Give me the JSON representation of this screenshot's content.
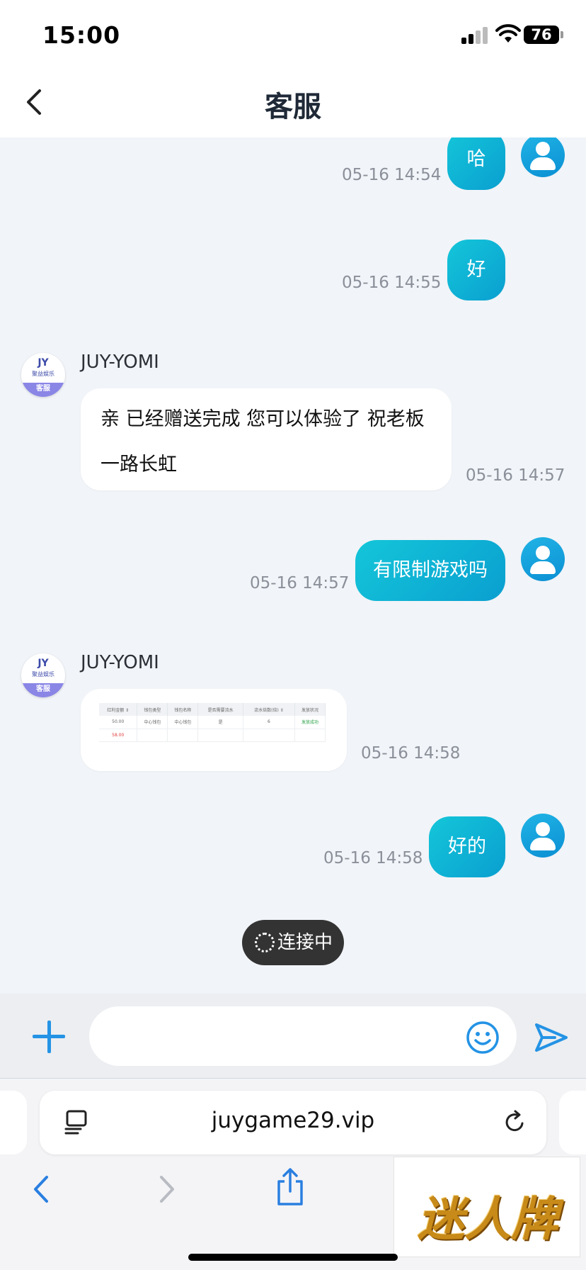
{
  "status_bar": {
    "time": "15:00",
    "battery": "76"
  },
  "header": {
    "title": "客服"
  },
  "messages": {
    "m1": {
      "text": "哈",
      "time": "05-16 14:54"
    },
    "m2": {
      "text": "好",
      "time": "05-16 14:55"
    },
    "m3": {
      "sender": "JUY-YOMI",
      "line1": "亲  已经赠送完成   您可以体验了   祝老板",
      "line2": "一路长虹",
      "time": "05-16 14:57"
    },
    "m4": {
      "text": "有限制游戏吗",
      "time": "05-16 14:57"
    },
    "m5": {
      "sender": "JUY-YOMI",
      "time": "05-16 14:58",
      "image_table": {
        "headers": [
          "红利金额 ⇕",
          "钱包类型",
          "钱包名称",
          "是否需要流水",
          "流水倍数(倍) ⇕",
          "发放状况"
        ],
        "row1": [
          "50.00",
          "中心钱包",
          "中心钱包",
          "是",
          "6",
          "发放成功"
        ],
        "row2": [
          "58.00",
          "",
          "",
          "",
          "",
          ""
        ]
      }
    },
    "m6": {
      "text": "好的",
      "time": "05-16 14:58"
    }
  },
  "agent_avatar": {
    "logo": "JY",
    "brand": "聚益娱乐",
    "ribbon": "客服"
  },
  "toast": {
    "text": "连接中"
  },
  "input": {
    "placeholder": ""
  },
  "browser": {
    "url": "juygame29.vip"
  },
  "watermark": {
    "text": "迷人牌"
  },
  "colors": {
    "user_bubble": "#14c6d9",
    "accent": "#2493e5",
    "background": "#f1f4f8"
  }
}
